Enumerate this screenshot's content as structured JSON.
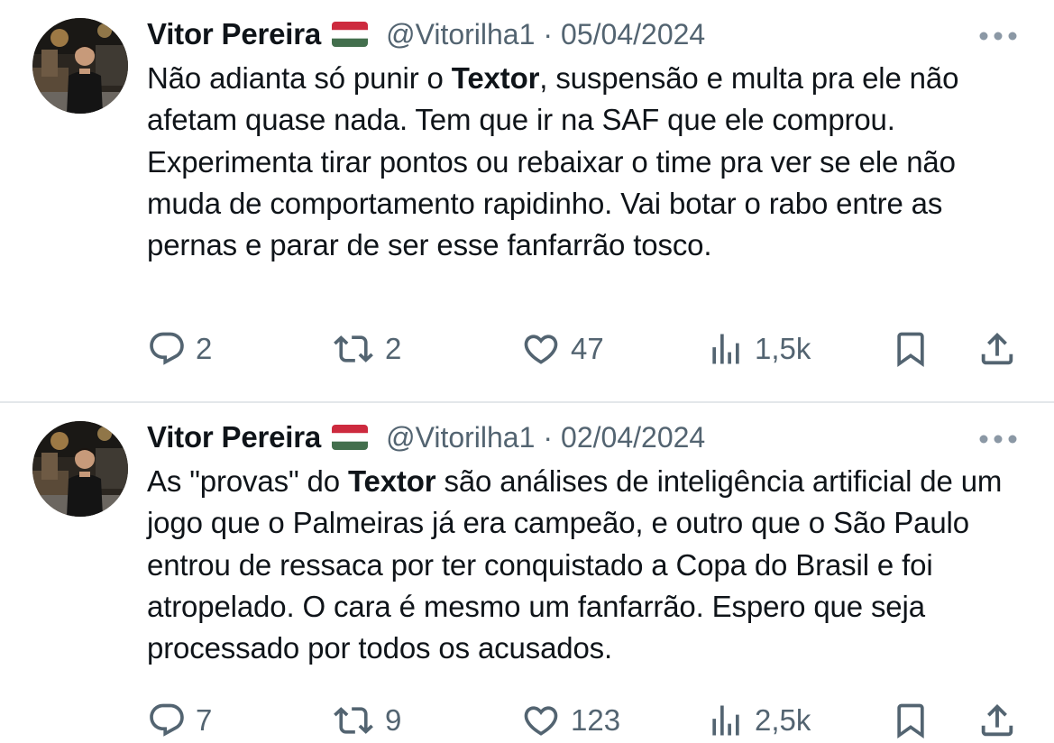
{
  "tweets": [
    {
      "author_name": "Vitor Pereira",
      "author_flag": "hungary-flag-icon",
      "handle": "@Vitorilha1",
      "separator": "·",
      "date": "05/04/2024",
      "text_parts": [
        {
          "text": "Não adianta só punir o ",
          "bold": false
        },
        {
          "text": "Textor",
          "bold": true
        },
        {
          "text": ", suspensão e multa pra ele não afetam quase nada. Tem que ir na SAF que ele comprou. Experimenta tirar pontos ou rebaixar o time pra ver se ele não muda de comportamento rapidinho. Vai botar o rabo entre as pernas e parar de ser esse fanfarrão tosco.",
          "bold": false
        }
      ],
      "replies": "2",
      "retweets": "2",
      "likes": "47",
      "views": "1,5k"
    },
    {
      "author_name": "Vitor Pereira",
      "author_flag": "hungary-flag-icon",
      "handle": "@Vitorilha1",
      "separator": "·",
      "date": "02/04/2024",
      "text_parts": [
        {
          "text": "As \"provas\" do ",
          "bold": false
        },
        {
          "text": "Textor",
          "bold": true
        },
        {
          "text": " são análises de inteligência artificial de um jogo que o Palmeiras já era campeão, e outro que o São Paulo entrou de ressaca por ter conquistado a Copa do Brasil e foi atropelado. O cara é mesmo um fanfarrão. Espero que seja processado por todos os acusados.",
          "bold": false
        }
      ],
      "replies": "7",
      "retweets": "9",
      "likes": "123",
      "views": "2,5k"
    }
  ],
  "icons": {
    "reply": "reply-icon",
    "retweet": "retweet-icon",
    "like": "heart-icon",
    "views": "views-icon",
    "bookmark": "bookmark-icon",
    "share": "share-icon",
    "more": "more-icon"
  },
  "colors": {
    "text": "#0f1419",
    "secondary": "#536471",
    "divider": "#e3e7ea",
    "flag_red": "#cd2a3e",
    "flag_white": "#ffffff",
    "flag_green": "#436f4d"
  }
}
